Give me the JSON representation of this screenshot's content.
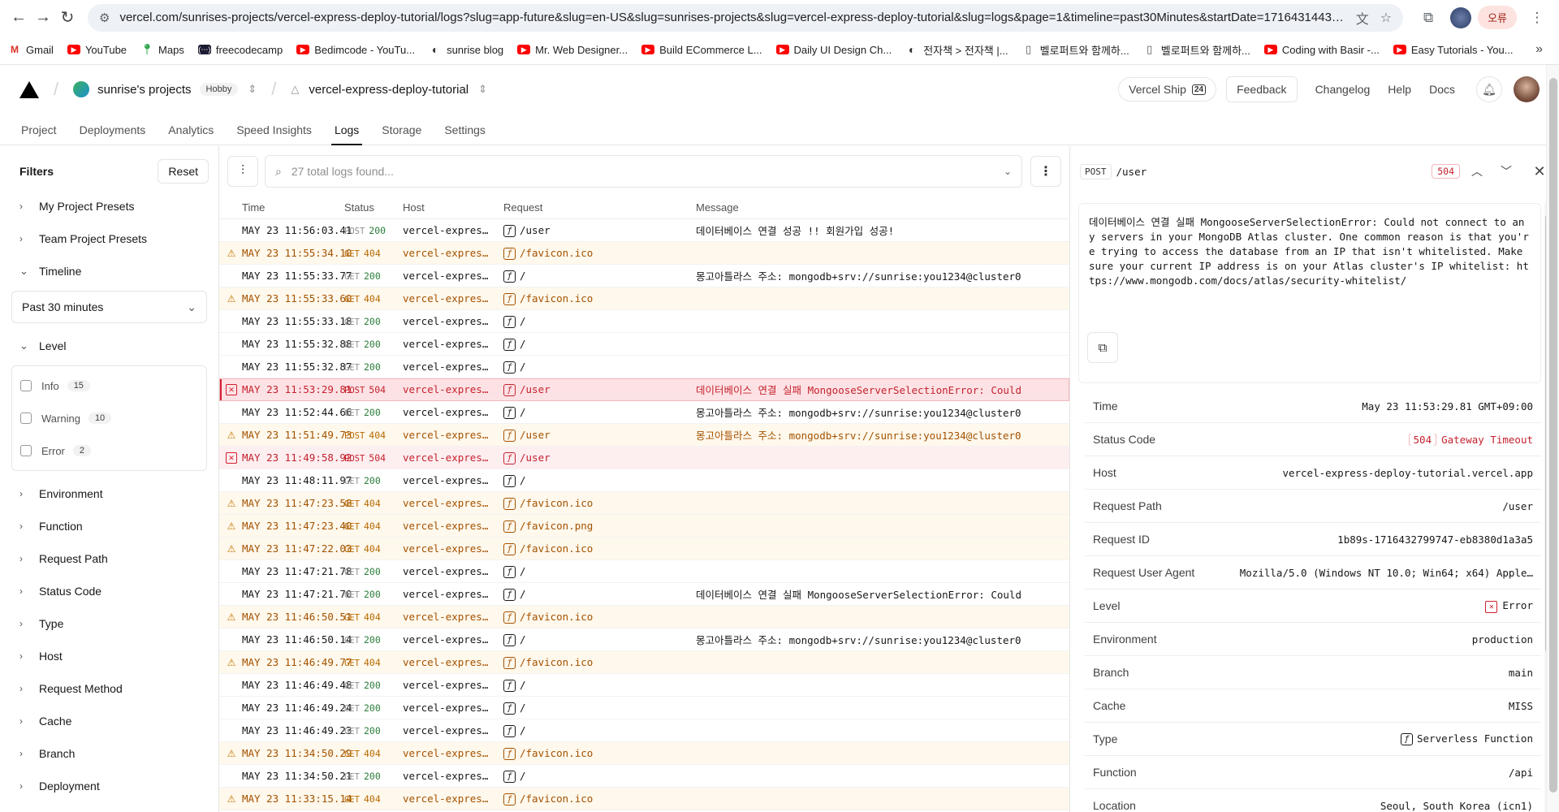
{
  "browser": {
    "url": "vercel.com/sunrises-projects/vercel-express-deploy-tutorial/logs?slug=app-future&slug=en-US&slug=sunrises-projects&slug=vercel-express-deploy-tutorial&slug=logs&page=1&timeline=past30Minutes&startDate=1716431443964&end...",
    "error_label": "오류",
    "bookmarks": [
      {
        "label": "Gmail",
        "icon": "gm"
      },
      {
        "label": "YouTube",
        "icon": "yt"
      },
      {
        "label": "Maps",
        "icon": "mp"
      },
      {
        "label": "freecodecamp",
        "icon": "fc"
      },
      {
        "label": "Bedimcode - YouTu...",
        "icon": "yt"
      },
      {
        "label": "sunrise blog",
        "icon": "gl"
      },
      {
        "label": "Mr. Web Designer...",
        "icon": "yt"
      },
      {
        "label": "Build ECommerce L...",
        "icon": "yt"
      },
      {
        "label": "Daily UI Design Ch...",
        "icon": "yt"
      },
      {
        "label": "전자책 > 전자책 |...",
        "icon": "gl"
      },
      {
        "label": "벨로퍼트와 함께하...",
        "icon": "bk"
      },
      {
        "label": "벨로퍼트와 함께하...",
        "icon": "bk"
      },
      {
        "label": "Coding with Basir -...",
        "icon": "yt"
      },
      {
        "label": "Easy Tutorials - You...",
        "icon": "yt"
      }
    ]
  },
  "header": {
    "team": "sunrise's projects",
    "plan": "Hobby",
    "project": "vercel-express-deploy-tutorial",
    "ship_label": "Vercel Ship",
    "ship_badge": "24",
    "feedback": "Feedback",
    "changelog": "Changelog",
    "help": "Help",
    "docs": "Docs"
  },
  "tabs": [
    "Project",
    "Deployments",
    "Analytics",
    "Speed Insights",
    "Logs",
    "Storage",
    "Settings"
  ],
  "active_tab": "Logs",
  "filters": {
    "title": "Filters",
    "reset": "Reset",
    "presets": [
      "My Project Presets",
      "Team Project Presets"
    ],
    "timeline_label": "Timeline",
    "timeline_value": "Past 30 minutes",
    "level_label": "Level",
    "levels": [
      {
        "name": "Info",
        "count": "15"
      },
      {
        "name": "Warning",
        "count": "10"
      },
      {
        "name": "Error",
        "count": "2"
      }
    ],
    "groups": [
      "Environment",
      "Function",
      "Request Path",
      "Status Code",
      "Type",
      "Host",
      "Request Method",
      "Cache",
      "Branch",
      "Deployment"
    ]
  },
  "logs": {
    "search_placeholder": "27 total logs found...",
    "columns": [
      "Time",
      "Status",
      "Host",
      "Request",
      "Message"
    ],
    "rows": [
      {
        "level": "info",
        "time": "MAY 23 11:56:03.41",
        "method": "POST",
        "status": "200",
        "host": "vercel-expres…",
        "path": "/user",
        "message": "데이터베이스 연결 성공 !! 회원가입 성공!"
      },
      {
        "level": "warning",
        "time": "MAY 23 11:55:34.10",
        "method": "GET",
        "status": "404",
        "host": "vercel-expres…",
        "path": "/favicon.ico",
        "message": ""
      },
      {
        "level": "info",
        "time": "MAY 23 11:55:33.77",
        "method": "GET",
        "status": "200",
        "host": "vercel-expres…",
        "path": "/",
        "message": "몽고아틀라스 주소: mongodb+srv://sunrise:you1234@cluster0"
      },
      {
        "level": "warning",
        "time": "MAY 23 11:55:33.60",
        "method": "GET",
        "status": "404",
        "host": "vercel-expres…",
        "path": "/favicon.ico",
        "message": ""
      },
      {
        "level": "info",
        "time": "MAY 23 11:55:33.18",
        "method": "GET",
        "status": "200",
        "host": "vercel-expres…",
        "path": "/",
        "message": ""
      },
      {
        "level": "info",
        "time": "MAY 23 11:55:32.88",
        "method": "GET",
        "status": "200",
        "host": "vercel-expres…",
        "path": "/",
        "message": ""
      },
      {
        "level": "info",
        "time": "MAY 23 11:55:32.87",
        "method": "GET",
        "status": "200",
        "host": "vercel-expres…",
        "path": "/",
        "message": ""
      },
      {
        "level": "error",
        "selected": true,
        "time": "MAY 23 11:53:29.81",
        "method": "POST",
        "status": "504",
        "host": "vercel-expres…",
        "path": "/user",
        "message": "데이터베이스 연결 실패 MongooseServerSelectionError: Could"
      },
      {
        "level": "info",
        "time": "MAY 23 11:52:44.66",
        "method": "GET",
        "status": "200",
        "host": "vercel-expres…",
        "path": "/",
        "message": "몽고아틀라스 주소: mongodb+srv://sunrise:you1234@cluster0"
      },
      {
        "level": "warning",
        "time": "MAY 23 11:51:49.73",
        "method": "POST",
        "status": "404",
        "host": "vercel-expres…",
        "path": "/user",
        "message": "몽고아틀라스 주소: mongodb+srv://sunrise:you1234@cluster0"
      },
      {
        "level": "error",
        "time": "MAY 23 11:49:58.92",
        "method": "POST",
        "status": "504",
        "host": "vercel-expres…",
        "path": "/user",
        "message": ""
      },
      {
        "level": "info",
        "time": "MAY 23 11:48:11.97",
        "method": "GET",
        "status": "200",
        "host": "vercel-expres…",
        "path": "/",
        "message": ""
      },
      {
        "level": "warning",
        "time": "MAY 23 11:47:23.58",
        "method": "GET",
        "status": "404",
        "host": "vercel-expres…",
        "path": "/favicon.ico",
        "message": ""
      },
      {
        "level": "warning",
        "time": "MAY 23 11:47:23.40",
        "method": "GET",
        "status": "404",
        "host": "vercel-expres…",
        "path": "/favicon.png",
        "message": ""
      },
      {
        "level": "warning",
        "time": "MAY 23 11:47:22.03",
        "method": "GET",
        "status": "404",
        "host": "vercel-expres…",
        "path": "/favicon.ico",
        "message": ""
      },
      {
        "level": "info",
        "time": "MAY 23 11:47:21.78",
        "method": "GET",
        "status": "200",
        "host": "vercel-expres…",
        "path": "/",
        "message": ""
      },
      {
        "level": "info",
        "time": "MAY 23 11:47:21.70",
        "method": "GET",
        "status": "200",
        "host": "vercel-expres…",
        "path": "/",
        "message": "데이터베이스 연결 실패 MongooseServerSelectionError: Could"
      },
      {
        "level": "warning",
        "time": "MAY 23 11:46:50.51",
        "method": "GET",
        "status": "404",
        "host": "vercel-expres…",
        "path": "/favicon.ico",
        "message": ""
      },
      {
        "level": "info",
        "time": "MAY 23 11:46:50.14",
        "method": "GET",
        "status": "200",
        "host": "vercel-expres…",
        "path": "/",
        "message": "몽고아틀라스 주소: mongodb+srv://sunrise:you1234@cluster0"
      },
      {
        "level": "warning",
        "time": "MAY 23 11:46:49.77",
        "method": "GET",
        "status": "404",
        "host": "vercel-expres…",
        "path": "/favicon.ico",
        "message": ""
      },
      {
        "level": "info",
        "time": "MAY 23 11:46:49.48",
        "method": "GET",
        "status": "200",
        "host": "vercel-expres…",
        "path": "/",
        "message": ""
      },
      {
        "level": "info",
        "time": "MAY 23 11:46:49.24",
        "method": "GET",
        "status": "200",
        "host": "vercel-expres…",
        "path": "/",
        "message": ""
      },
      {
        "level": "info",
        "time": "MAY 23 11:46:49.23",
        "method": "GET",
        "status": "200",
        "host": "vercel-expres…",
        "path": "/",
        "message": ""
      },
      {
        "level": "warning",
        "time": "MAY 23 11:34:50.29",
        "method": "GET",
        "status": "404",
        "host": "vercel-expres…",
        "path": "/favicon.ico",
        "message": ""
      },
      {
        "level": "info",
        "time": "MAY 23 11:34:50.21",
        "method": "GET",
        "status": "200",
        "host": "vercel-expres…",
        "path": "/",
        "message": ""
      },
      {
        "level": "warning",
        "time": "MAY 23 11:33:15.14",
        "method": "GET",
        "status": "404",
        "host": "vercel-expres…",
        "path": "/favicon.ico",
        "message": ""
      }
    ]
  },
  "detail": {
    "method": "POST",
    "path": "/user",
    "status_code": "504",
    "message": "데이터베이스 연결 실패 MongooseServerSelectionError: Could not connect to any servers in your MongoDB Atlas cluster. One common reason is that you're trying to access the database from an IP that isn't whitelisted. Make sure your current IP address is on your Atlas cluster's IP whitelist: https://www.mongodb.com/docs/atlas/security-whitelist/",
    "fields": [
      {
        "key": "Time",
        "value": "May 23 11:53:29.81 GMT+09:00"
      },
      {
        "key": "Status Code",
        "badge": "504",
        "value": "Gateway Timeout",
        "style": "status"
      },
      {
        "key": "Host",
        "value": "vercel-express-deploy-tutorial.vercel.app"
      },
      {
        "key": "Request Path",
        "value": "/user"
      },
      {
        "key": "Request ID",
        "value": "1b89s-1716432799747-eb8380d1a3a5"
      },
      {
        "key": "Request User Agent",
        "value": "Mozilla/5.0 (Windows NT 10.0; Win64; x64) Apple…"
      },
      {
        "key": "Level",
        "value": "Error",
        "style": "error"
      },
      {
        "key": "Environment",
        "value": "production"
      },
      {
        "key": "Branch",
        "value": "main"
      },
      {
        "key": "Cache",
        "value": "MISS"
      },
      {
        "key": "Type",
        "value": "Serverless Function",
        "style": "fn"
      },
      {
        "key": "Function",
        "value": "/api"
      },
      {
        "key": "Location",
        "value": "Seoul, South Korea (icn1)"
      }
    ]
  }
}
